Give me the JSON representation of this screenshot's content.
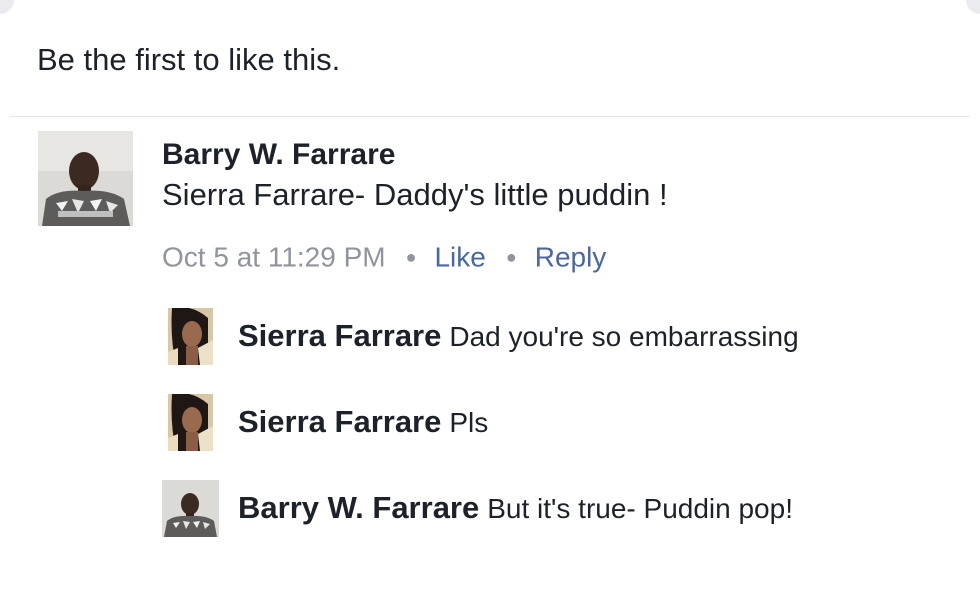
{
  "likes": {
    "text": "Be the first to like this."
  },
  "comment": {
    "author": "Barry W. Farrare",
    "text": "Sierra Farrare- Daddy's little puddin !",
    "timestamp": "Oct 5 at 11:29 PM",
    "like_label": "Like",
    "reply_label": "Reply",
    "avatar_icon": "profile-photo-man"
  },
  "replies": [
    {
      "author": "Sierra Farrare",
      "text": "Dad you're so embarrassing",
      "avatar_icon": "profile-photo-woman"
    },
    {
      "author": "Sierra Farrare",
      "text": "Pls",
      "avatar_icon": "profile-photo-woman"
    },
    {
      "author": "Barry W. Farrare",
      "text": "But it's true- Puddin pop!",
      "avatar_icon": "profile-photo-man"
    }
  ],
  "colors": {
    "text": "#1d2129",
    "meta": "#90949c",
    "link": "#4b67a1",
    "divider": "#e5e6e9"
  }
}
